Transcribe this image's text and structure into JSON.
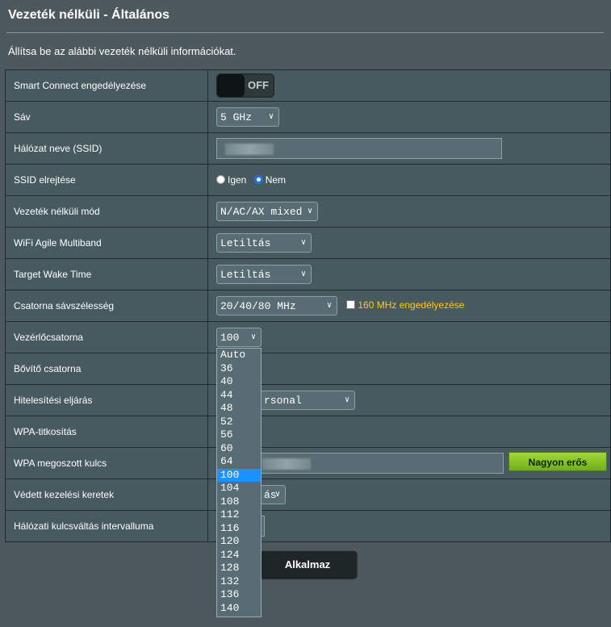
{
  "page": {
    "title": "Vezeték nélküli - Általános",
    "description": "Állítsa be az alábbi vezeték nélküli információkat."
  },
  "rows": {
    "smart_connect": {
      "label": "Smart Connect engedélyezése",
      "state": "OFF"
    },
    "band": {
      "label": "Sáv",
      "value": "5 GHz"
    },
    "ssid": {
      "label": "Hálózat neve (SSID)"
    },
    "hide_ssid": {
      "label": "SSID elrejtése",
      "yes": "Igen",
      "no": "Nem",
      "selected": "Nem"
    },
    "wireless_mode": {
      "label": "Vezeték nélküli mód",
      "value": "N/AC/AX mixed"
    },
    "agile_multiband": {
      "label": "WiFi Agile Multiband",
      "value": "Letiltás"
    },
    "target_wake_time": {
      "label": "Target Wake Time",
      "value": "Letiltás"
    },
    "bandwidth": {
      "label": "Csatorna sávszélesség",
      "value": "20/40/80 MHz",
      "enable_160": "160 MHz engedélyezése"
    },
    "control_channel": {
      "label": "Vezérlőcsatorna",
      "value": "100"
    },
    "extension_channel": {
      "label": "Bővítő csatorna"
    },
    "auth_method": {
      "label": "Hitelesítési eljárás",
      "value_visible": "rsonal"
    },
    "wpa_encryption": {
      "label": "WPA-titkosítás"
    },
    "wpa_key": {
      "label": "WPA megoszott kulcs",
      "strength": "Nagyon erős"
    },
    "pmf": {
      "label": "Védett kezelési keretek",
      "value_visible": "ás"
    },
    "key_rotation": {
      "label": "Hálózati kulcsváltás intervalluma"
    }
  },
  "channel_options": [
    "Auto",
    "36",
    "40",
    "44",
    "48",
    "52",
    "56",
    "60",
    "64",
    "100",
    "104",
    "108",
    "112",
    "116",
    "120",
    "124",
    "128",
    "132",
    "136",
    "140"
  ],
  "channel_selected": "100",
  "apply_button": "Alkalmaz",
  "colors": {
    "accent": "#ffcc00",
    "selection": "#1e90ff",
    "strength": "#8fc62a"
  }
}
